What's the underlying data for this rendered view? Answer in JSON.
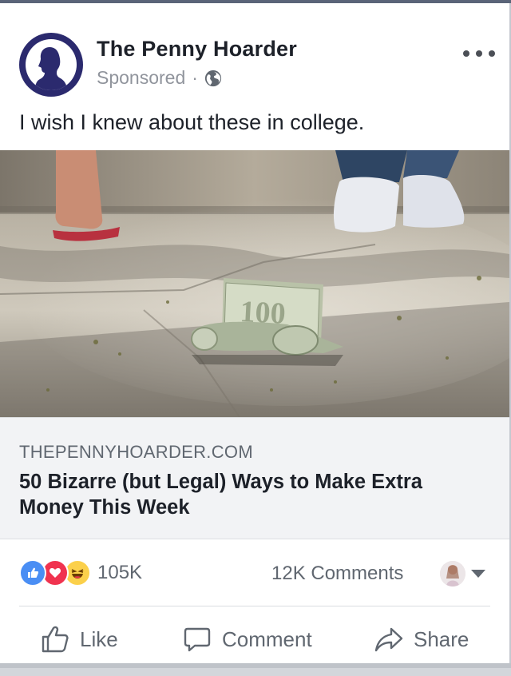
{
  "post": {
    "page_name": "The Penny Hoarder",
    "sponsored_label": "Sponsored",
    "separator": "·",
    "privacy_icon": "globe-icon",
    "more_icon": "more-options-icon",
    "message": "I wish I knew about these in college."
  },
  "link_preview": {
    "domain": "THEPENNYHOARDER.COM",
    "title": "50 Bizarre (but Legal) Ways to Make Extra Money This Week"
  },
  "engagement": {
    "reactions": [
      "like-reaction-icon",
      "love-reaction-icon",
      "haha-reaction-icon"
    ],
    "reaction_count": "105K",
    "comments_count": "12K Comments"
  },
  "actions": {
    "like_label": "Like",
    "comment_label": "Comment",
    "share_label": "Share"
  },
  "colors": {
    "brand_navy": "#2b2a6e",
    "like_blue": "#4a8ef4",
    "love_red": "#f0334f",
    "haha_yellow": "#fbd04b",
    "muted_text": "#606770"
  }
}
